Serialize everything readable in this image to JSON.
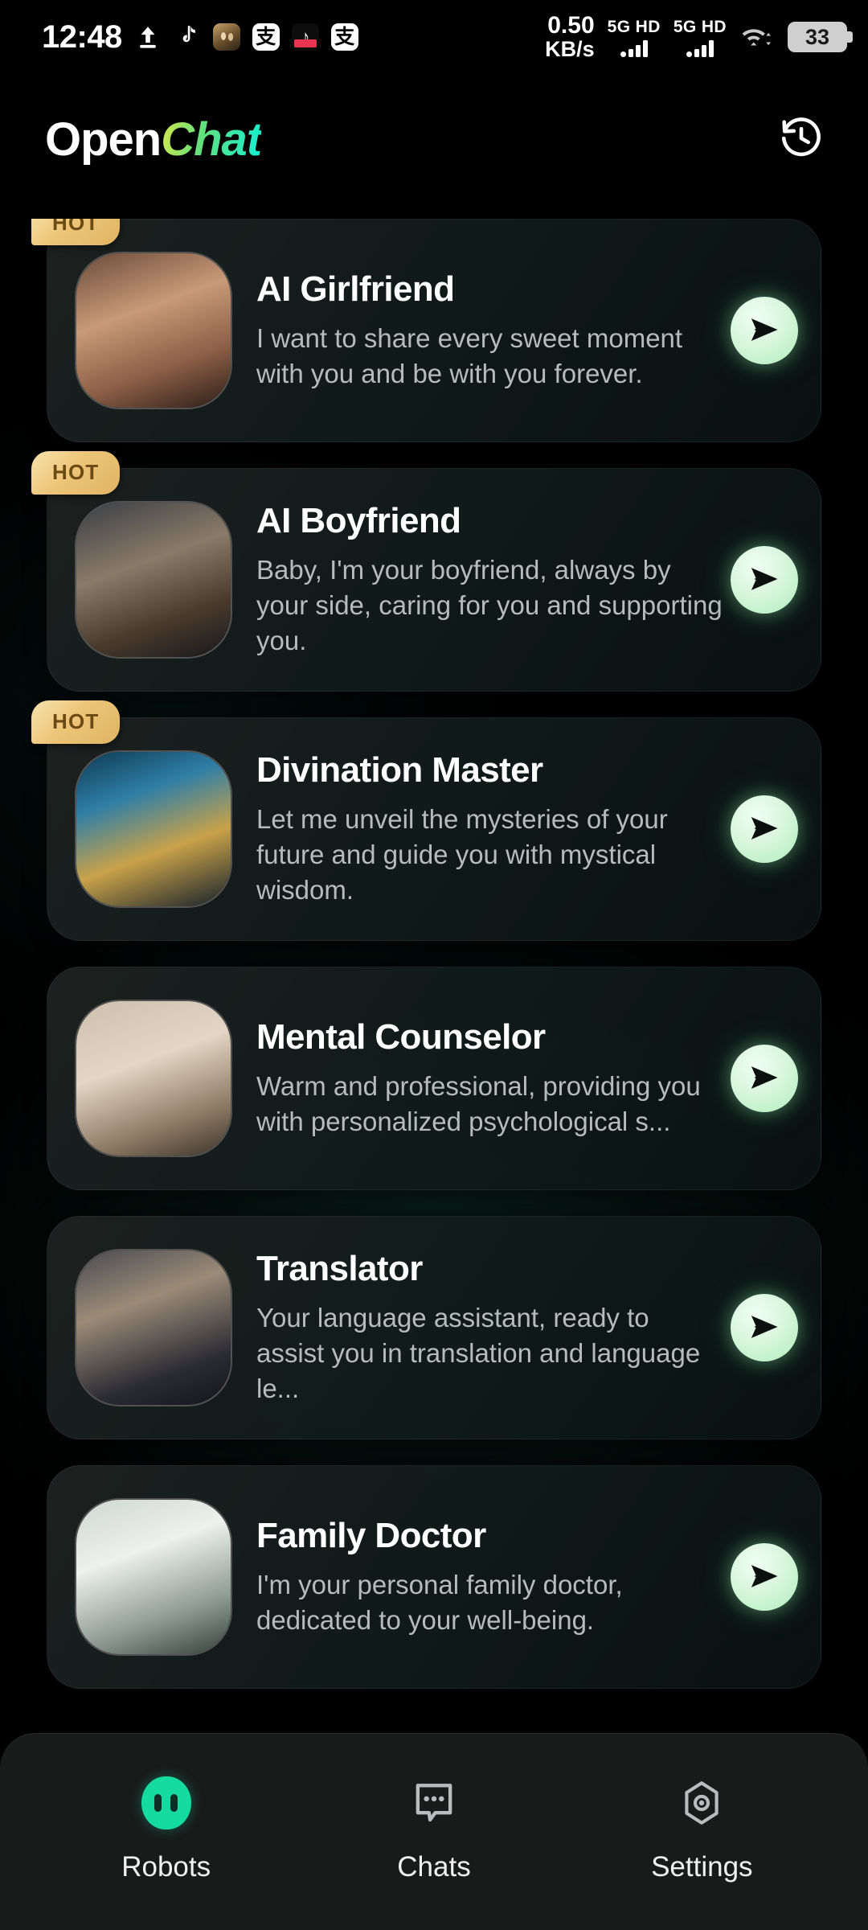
{
  "status_bar": {
    "time": "12:48",
    "network_speed_value": "0.50",
    "network_speed_unit": "KB/s",
    "sim1_label": "5G HD",
    "sim2_label": "5G HD",
    "battery_percent": "33",
    "icons": [
      "upload-icon",
      "tiktok-music-icon",
      "pubg-app-icon",
      "alipay-app-icon",
      "tiktok-app-icon",
      "alipay-app-icon"
    ]
  },
  "header": {
    "logo_part1": "Open",
    "logo_part2": "Chat",
    "history_icon": "history-clock-icon"
  },
  "theme": {
    "accent_green": "#16dba0",
    "send_button_green": "#aeeeba",
    "hot_badge_gold": "#edc578",
    "logo_gradient_start": "#d9e84a",
    "logo_gradient_end": "#14f0d4",
    "card_background": "#131d1c",
    "nav_background": "#191a1a",
    "title_color": "#ffffff",
    "desc_color": "#b4bcbc"
  },
  "robots": [
    {
      "name": "AI Girlfriend",
      "description": "I want to share every sweet moment with you and be with you forever.",
      "badge": "HOT",
      "avatar": "ai-girlfriend-avatar",
      "action": "start-chat"
    },
    {
      "name": "AI Boyfriend",
      "description": "Baby, I'm your boyfriend, always by your side, caring for you and supporting you.",
      "badge": "HOT",
      "avatar": "ai-boyfriend-avatar",
      "action": "start-chat"
    },
    {
      "name": "Divination Master",
      "description": "Let me unveil the mysteries of your future and guide you with mystical wisdom.",
      "badge": "HOT",
      "avatar": "divination-master-avatar",
      "action": "start-chat"
    },
    {
      "name": "Mental Counselor",
      "description": "Warm and professional, providing you with personalized psychological s...",
      "badge": "",
      "avatar": "mental-counselor-avatar",
      "action": "start-chat"
    },
    {
      "name": "Translator",
      "description": "Your language assistant, ready to assist you in translation and language le...",
      "badge": "",
      "avatar": "translator-avatar",
      "action": "start-chat"
    },
    {
      "name": "Family Doctor",
      "description": "I'm your personal family doctor, dedicated to your well-being.",
      "badge": "",
      "avatar": "family-doctor-avatar",
      "action": "start-chat"
    }
  ],
  "bottom_nav": {
    "active": "Robots",
    "items": [
      {
        "label": "Robots",
        "icon": "robot-face-icon"
      },
      {
        "label": "Chats",
        "icon": "chat-bubble-icon"
      },
      {
        "label": "Settings",
        "icon": "hexagon-gear-icon"
      }
    ]
  }
}
